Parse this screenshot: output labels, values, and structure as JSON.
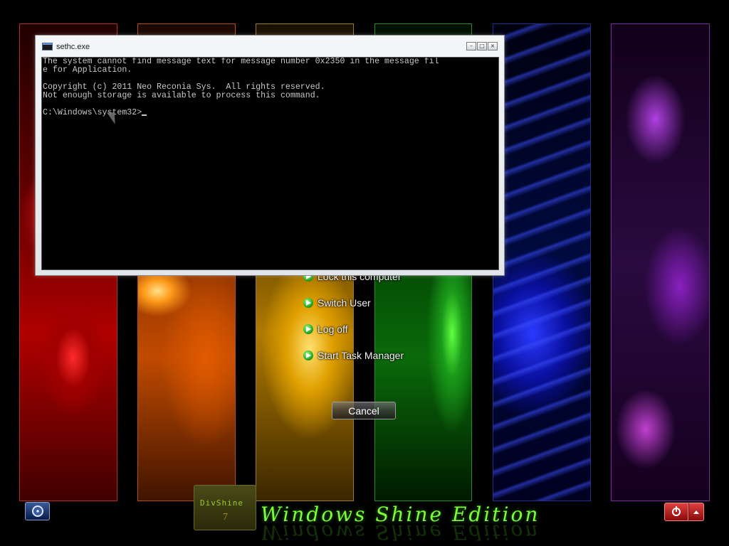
{
  "console_window": {
    "title": "sethc.exe",
    "buttons": {
      "minimize": "–",
      "maximize": "□",
      "close": "×"
    },
    "lines": [
      "The system cannot find message text for message number 0x2350 in the message fil",
      "e for Application.",
      "",
      "Copyright (c) 2011 Neo Reconia Sys.  All rights reserved.",
      "Not enough storage is available to process this command.",
      "",
      "C:\\Windows\\system32>"
    ]
  },
  "security_menu": {
    "items": [
      {
        "label": "Lock this computer",
        "icon": "green-arrow-icon"
      },
      {
        "label": "Switch User",
        "icon": "green-arrow-icon"
      },
      {
        "label": "Log off",
        "icon": "green-arrow-icon"
      },
      {
        "label": "Start Task Manager",
        "icon": "green-arrow-icon"
      }
    ],
    "cancel_label": "Cancel"
  },
  "branding": {
    "logo_text": "DivShine",
    "logo_number": "7",
    "title": "Windows Shine Edition"
  },
  "bottom_bar": {
    "ease_of_access_icon": "ease-of-access-icon",
    "power_icon": "power-icon",
    "power_menu_icon": "up-arrow-icon"
  },
  "colors": {
    "brand_green": "#7cfc3a",
    "power_red": "#c81e1e",
    "console_bg": "#000000",
    "console_text": "#c8c8c8"
  }
}
